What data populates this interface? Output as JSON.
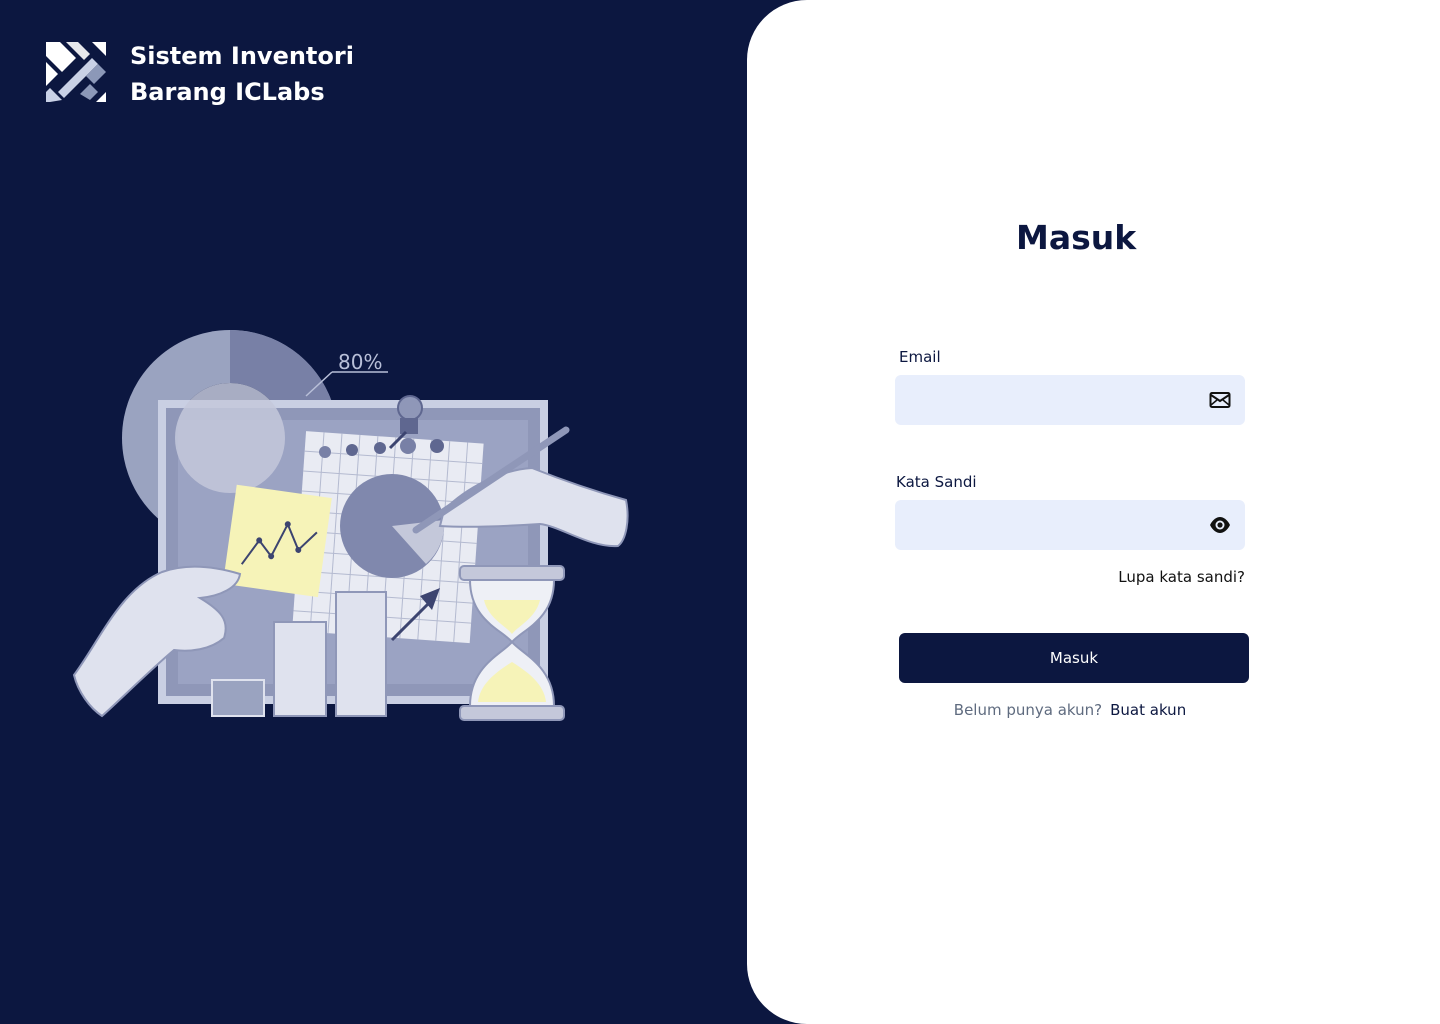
{
  "brand": {
    "logo_icon": "iclabs-logo-icon",
    "title_line1": "Sistem Inventori",
    "title_line2": "Barang ICLabs"
  },
  "illustration": {
    "icon": "analytics-illustration",
    "percent_label": "80%"
  },
  "form": {
    "title": "Masuk",
    "email": {
      "label": "Email",
      "value": "",
      "icon": "envelope-icon"
    },
    "password": {
      "label": "Kata Sandi",
      "value": "",
      "icon": "eye-icon"
    },
    "forgot_label": "Lupa kata sandi?",
    "submit_label": "Masuk",
    "signup_prompt": "Belum punya akun?",
    "signup_link": "Buat akun"
  },
  "colors": {
    "navy": "#0c1740",
    "input_bg": "#e8eefc",
    "white": "#ffffff",
    "muted_text": "#5f6b7f"
  }
}
